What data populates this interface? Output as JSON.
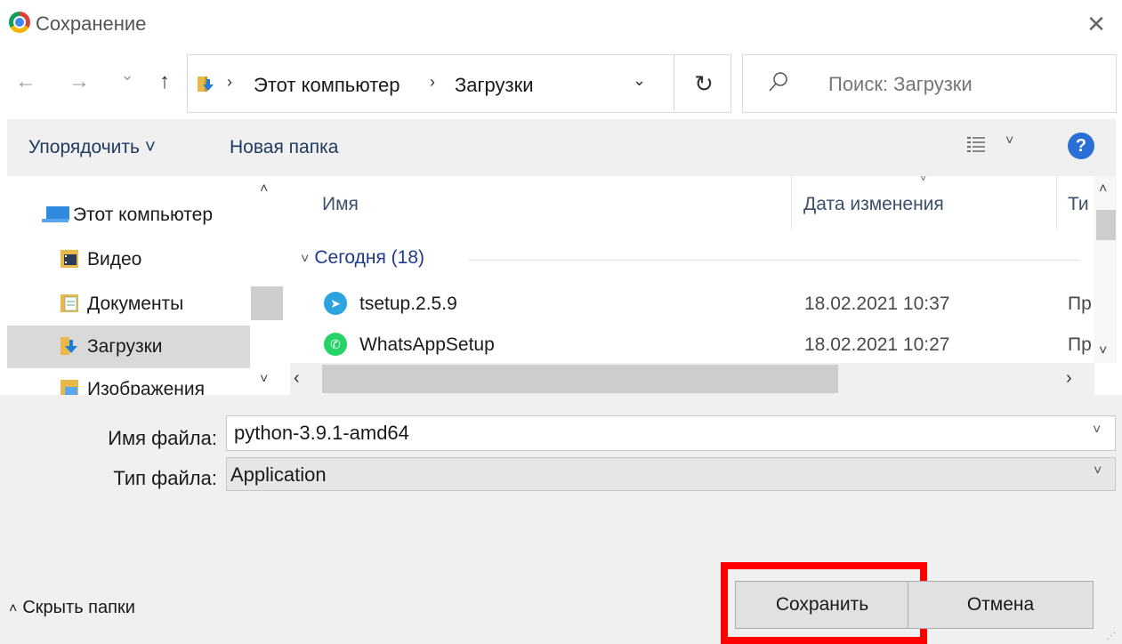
{
  "window": {
    "title": "Сохранение",
    "close_glyph": "✕"
  },
  "nav": {
    "back": "←",
    "forward": "→",
    "recent": "⌄",
    "up": "↑"
  },
  "address": {
    "crumbs": [
      "Этот компьютер",
      "Загрузки"
    ],
    "separator": "›",
    "dropdown": "⌄",
    "refresh": "↻"
  },
  "search": {
    "placeholder": "Поиск: Загрузки"
  },
  "toolbar": {
    "organize": "Упорядочить ˅",
    "new_folder": "Новая папка",
    "view_caret": "˅",
    "help": "?"
  },
  "sidebar": {
    "items": [
      {
        "label": "Этот компьютер",
        "icon": "computer-icon"
      },
      {
        "label": "Видео",
        "icon": "video-folder-icon"
      },
      {
        "label": "Документы",
        "icon": "documents-folder-icon"
      },
      {
        "label": "Загрузки",
        "icon": "downloads-folder-icon",
        "selected": true
      },
      {
        "label": "Изображения",
        "icon": "pictures-folder-icon"
      }
    ],
    "scroll_up": "˄",
    "scroll_down": "˅"
  },
  "files": {
    "columns": {
      "name": "Имя",
      "date": "Дата изменения",
      "type": "Ти"
    },
    "sort_indicator": "˅",
    "group": {
      "label": "Сегодня (18)",
      "chevron": "˅"
    },
    "rows": [
      {
        "name": "tsetup.2.5.9",
        "date": "18.02.2021 10:37",
        "type": "Пр",
        "icon": "telegram-icon",
        "icon_glyph": "➤",
        "color": "#2aa3df"
      },
      {
        "name": "WhatsAppSetup",
        "date": "18.02.2021 10:27",
        "type": "Пр",
        "icon": "whatsapp-icon",
        "icon_glyph": "✆",
        "color": "#25d366"
      }
    ],
    "scroll_left": "‹",
    "scroll_right": "›",
    "scroll_up": "˄",
    "scroll_down": "˅"
  },
  "form": {
    "filename_label": "Имя файла:",
    "filename_value": "python-3.9.1-amd64",
    "filetype_label": "Тип файла:",
    "filetype_value": "Application",
    "chevron": "˅"
  },
  "footer": {
    "hide_folders": "Скрыть папки",
    "hide_arrow": "˄",
    "save": "Сохранить",
    "cancel": "Отмена",
    "highlight_color": "#ff0000"
  }
}
